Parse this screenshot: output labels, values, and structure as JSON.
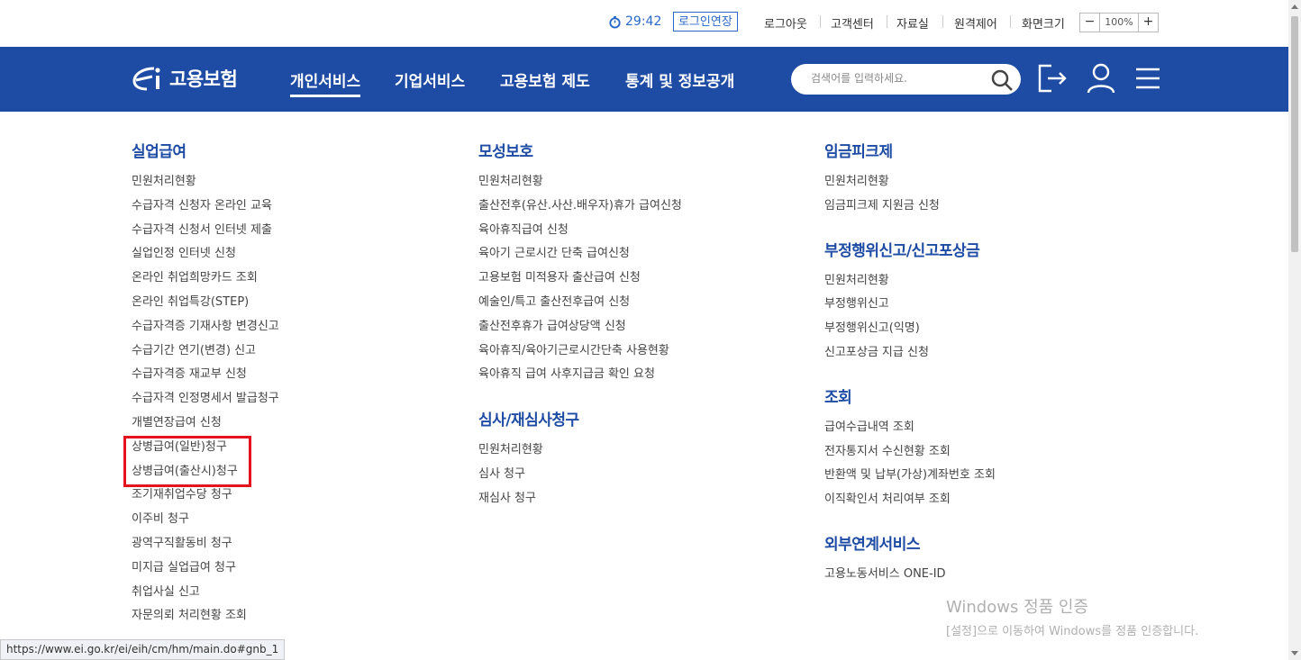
{
  "util": {
    "timer": "29:42",
    "extend_login": "로그인연장",
    "links": [
      "로그아웃",
      "고객센터",
      "자료실",
      "원격제어",
      "화면크기"
    ],
    "zoom_minus": "−",
    "zoom_value": "100%",
    "zoom_plus": "+"
  },
  "nav": {
    "logo_text": "고용보험",
    "menus": [
      "개인서비스",
      "기업서비스",
      "고용보험 제도",
      "통계 및 정보공개"
    ],
    "active_menu": "개인서비스",
    "search_placeholder": "검색어를 입력하세요."
  },
  "columns": [
    {
      "sections": [
        {
          "title": "실업급여",
          "items": [
            "민원처리현황",
            "수급자격 신청자 온라인 교육",
            "수급자격 신청서 인터넷 제출",
            "실업인정 인터넷 신청",
            "온라인 취업희망카드 조회",
            "온라인 취업특강(STEP)",
            "수급자격증 기재사항 변경신고",
            "수급기간 연기(변경) 신고",
            "수급자격증 재교부 신청",
            "수급자격 인정명세서 발급청구",
            "개별연장급여 신청",
            "상병급여(일반)청구",
            "상병급여(출산시)청구",
            "조기재취업수당 청구",
            "이주비 청구",
            "광역구직활동비 청구",
            "미지급 실업급여 청구",
            "취업사실 신고",
            "자문의뢰 처리현황 조회"
          ]
        }
      ]
    },
    {
      "sections": [
        {
          "title": "모성보호",
          "items": [
            "민원처리현황",
            "출산전후(유산.사산.배우자)휴가 급여신청",
            "육아휴직급여 신청",
            "육아기 근로시간 단축 급여신청",
            "고용보험 미적용자 출산급여 신청",
            "예술인/특고 출산전후급여 신청",
            "출산전후휴가 급여상당액 신청",
            "육아휴직/육아기근로시간단축 사용현황",
            "육아휴직 급여 사후지급금 확인 요청"
          ]
        },
        {
          "title": "심사/재심사청구",
          "items": [
            "민원처리현황",
            "심사 청구",
            "재심사 청구"
          ]
        }
      ]
    },
    {
      "sections": [
        {
          "title": "임금피크제",
          "items": [
            "민원처리현황",
            "임금피크제 지원금 신청"
          ]
        },
        {
          "title": "부정행위신고/신고포상금",
          "items": [
            "민원처리현황",
            "부정행위신고",
            "부정행위신고(익명)",
            "신고포상금 지급 신청"
          ]
        },
        {
          "title": "조회",
          "items": [
            "급여수급내역 조회",
            "전자통지서 수신현황 조회",
            "반환액 및 납부(가상)계좌번호 조회",
            "이직확인서 처리여부 조회"
          ]
        },
        {
          "title": "외부연계서비스",
          "items": [
            "고용노동서비스 ONE-ID"
          ]
        }
      ]
    }
  ],
  "status_url": "https://www.ei.go.kr/ei/eih/cm/hm/main.do#gnb_1",
  "watermark": {
    "line1": "Windows 정품 인증",
    "line2": "[설정]으로 이동하여 Windows를 정품 인증합니다."
  },
  "colors": {
    "brand_blue": "#1e4ba3",
    "accent_blue": "#2a68c8",
    "highlight_red": "#e3141e"
  }
}
